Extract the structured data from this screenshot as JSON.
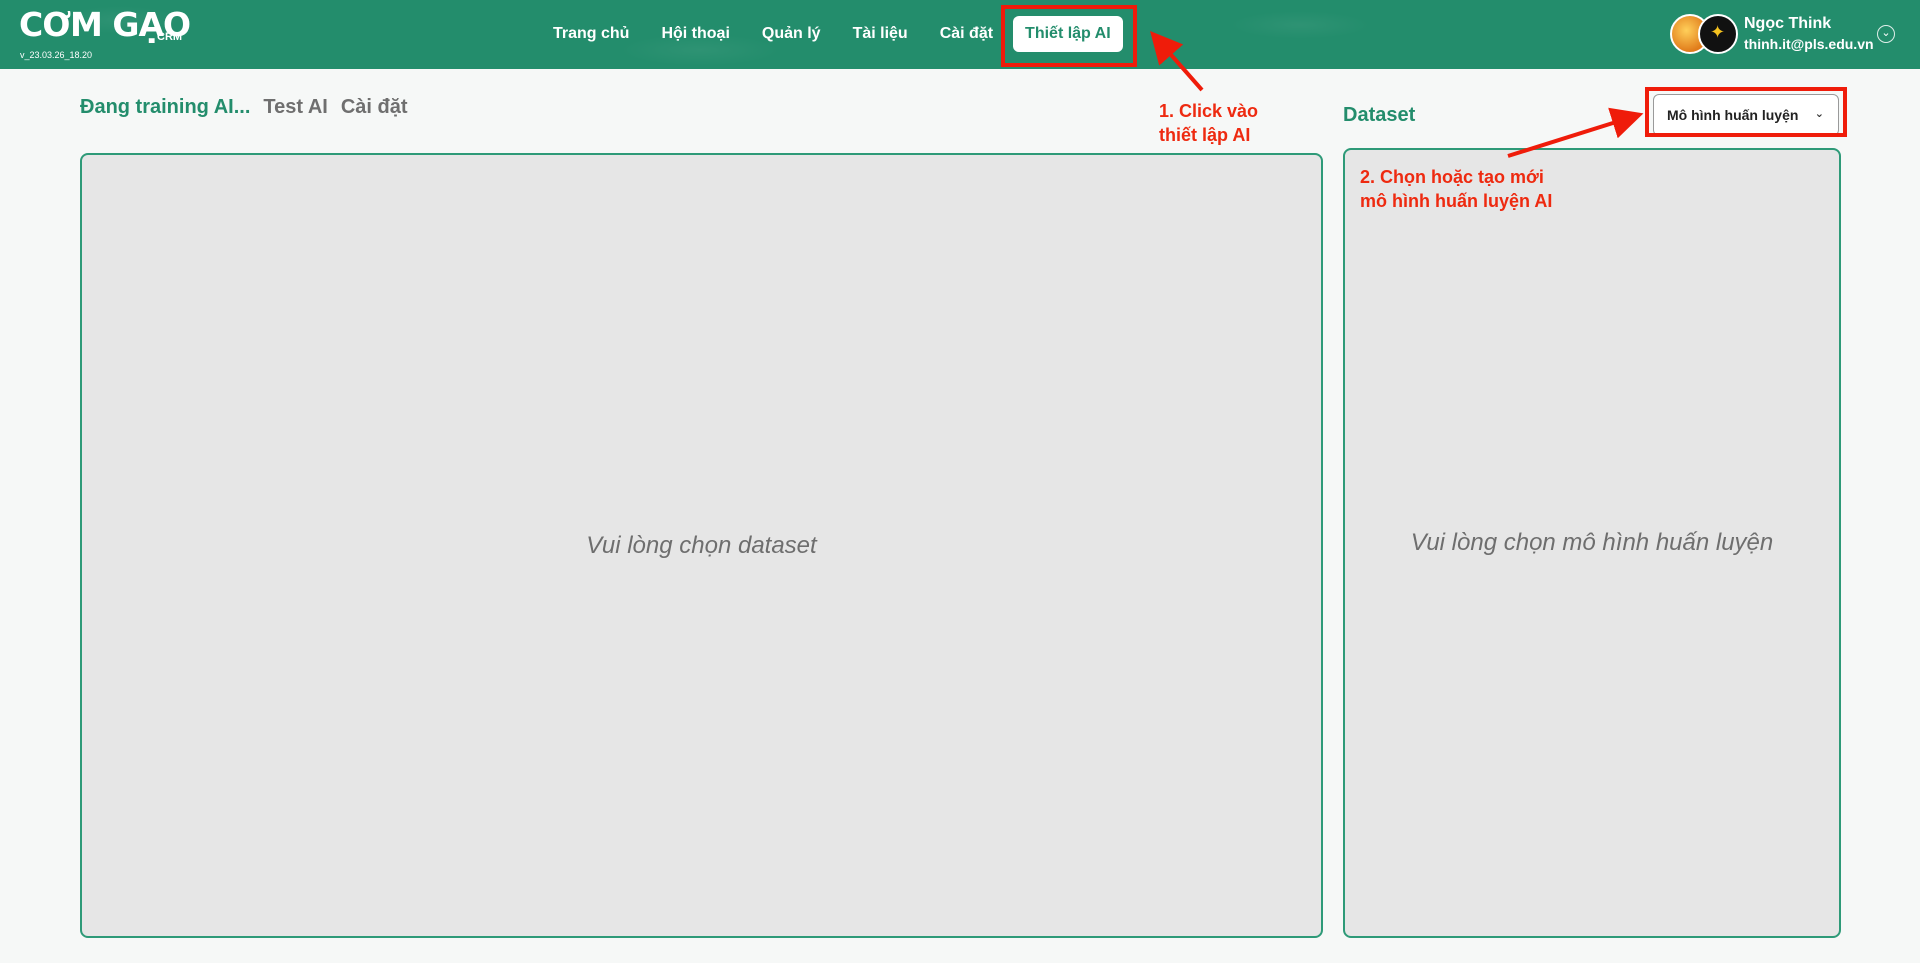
{
  "app": {
    "logo_text": "CƠM GẠO",
    "logo_suffix": "CRM",
    "version": "v_23.03.26_18.20"
  },
  "nav": {
    "items": [
      {
        "label": "Trang chủ"
      },
      {
        "label": "Hội thoại"
      },
      {
        "label": "Quản lý"
      },
      {
        "label": "Tài liệu"
      },
      {
        "label": "Cài đặt"
      },
      {
        "label": "Thiết lập AI"
      }
    ]
  },
  "user": {
    "name": "Ngọc Think",
    "email": "thinh.it@pls.edu.vn"
  },
  "tabs": [
    {
      "label": "Đang training AI..."
    },
    {
      "label": "Test AI"
    },
    {
      "label": "Cài đặt"
    }
  ],
  "main": {
    "left_placeholder": "Vui lòng chọn dataset",
    "dataset_label": "Dataset",
    "model_select_label": "Mô hình huấn luyện",
    "right_placeholder": "Vui lòng chọn mô hình huấn luyện"
  },
  "annotations": {
    "step1_line1": "1. Click vào",
    "step1_line2": "thiết lập AI",
    "step2_line1": "2. Chọn hoặc tạo mới",
    "step2_line2": "mô hình huấn luyện AI"
  },
  "colors": {
    "brand": "#238d6c",
    "annotation": "#ef1c0a",
    "panel_bg": "#e6e6e6"
  }
}
